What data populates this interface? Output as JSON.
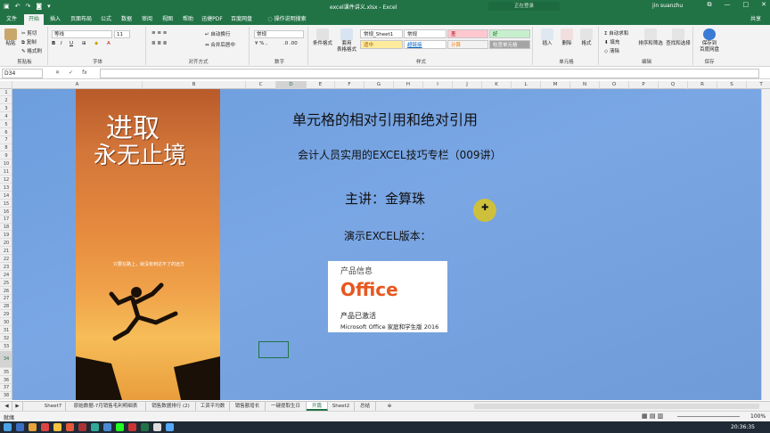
{
  "titlebar": {
    "document": "excel课件讲义.xlsx - Excel",
    "signin": "正在登录",
    "user": "jin suanzhu",
    "autosave": "",
    "restore": "□",
    "minimize": "—",
    "close": "✕",
    "ribbon_opt": "⧉"
  },
  "tabs": [
    "文件",
    "开始",
    "插入",
    "页面布局",
    "公式",
    "数据",
    "审阅",
    "视图",
    "帮助",
    "迅捷PDF",
    "百度网盘",
    "操作说明搜索"
  ],
  "share": "共享",
  "ribbon": {
    "clipboard": {
      "label": "剪贴板",
      "paste": "粘贴",
      "cut": "剪切",
      "copy": "复制",
      "format_painter": "格式刷"
    },
    "font": {
      "label": "字体",
      "name": "等线",
      "size": "11",
      "bold": "B",
      "italic": "I",
      "underline": "U"
    },
    "alignment": {
      "label": "对齐方式",
      "wrap": "自动换行",
      "merge": "合并后居中"
    },
    "number": {
      "label": "数字",
      "format": "常规"
    },
    "styles": {
      "label": "样式",
      "conditional": "条件格式",
      "table": "套用\n表格格式",
      "cells": [
        [
          "常规_Sheet1",
          "常规",
          "差",
          "好"
        ],
        [
          "适中",
          "超链接",
          "计算",
          "检查单元格"
        ]
      ]
    },
    "cells_group": {
      "label": "单元格",
      "insert": "插入",
      "delete": "删除",
      "format": "格式"
    },
    "editing": {
      "label": "编辑",
      "autosum": "自动求和",
      "fill": "填充",
      "clear": "清除",
      "sort": "排序和筛选",
      "find": "查找和选择"
    },
    "save": {
      "label": "保存",
      "button": "保存到\n百度网盘"
    }
  },
  "formula_bar": {
    "cell": "D34",
    "cancel": "✕",
    "enter": "✓",
    "fx": "fx",
    "value": ""
  },
  "columns": [
    "A",
    "B",
    "C",
    "D",
    "E",
    "F",
    "G",
    "H",
    "I",
    "J",
    "K",
    "L",
    "M",
    "N",
    "O",
    "P",
    "Q",
    "R",
    "S",
    "T"
  ],
  "active_column": "D",
  "active_row": "34",
  "rows": [
    "1",
    "2",
    "3",
    "4",
    "5",
    "6",
    "7",
    "8",
    "9",
    "10",
    "11",
    "12",
    "13",
    "14",
    "15",
    "16",
    "17",
    "18",
    "19",
    "20",
    "21",
    "22",
    "23",
    "24",
    "25",
    "26",
    "27",
    "28",
    "29",
    "30",
    "31",
    "32",
    "33",
    "34",
    "35",
    "36",
    "37",
    "38",
    "39"
  ],
  "content": {
    "title": "单元格的相对引用和绝对引用",
    "subtitle": "会计人员实用的EXCEL技巧专栏（009讲）",
    "lecturer": "主讲：金算珠",
    "version_label": "演示EXCEL版本：",
    "poster_calligraphy_1": "进取",
    "poster_calligraphy_2": "永无止境",
    "poster_tagline": "只要在路上，就没有到达不了的远方"
  },
  "office_info": {
    "heading": "产品信息",
    "logo": "Office",
    "activated": "产品已激活",
    "version": "Microsoft Office 家庭和学生版 2016"
  },
  "sheet_tabs": [
    "Sheet7",
    "原始数据-7月销售毛利明细表",
    "销售数据排行 (2)",
    "工资平均数",
    "销售额增长",
    "一键提取生日",
    "开篇",
    "Sheet2",
    "总结"
  ],
  "active_sheet": "开篇",
  "status": {
    "ready": "就绪",
    "zoom": "100%"
  },
  "taskbar": {
    "time": "20:36:35"
  }
}
